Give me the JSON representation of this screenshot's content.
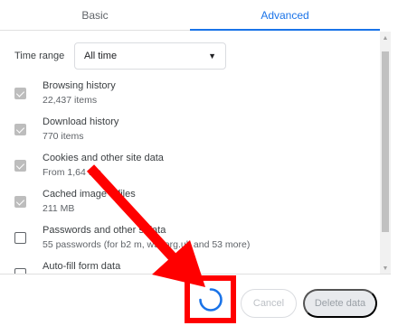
{
  "tabs": {
    "basic_label": "Basic",
    "advanced_label": "Advanced"
  },
  "time_range": {
    "label": "Time range",
    "selected": "All time"
  },
  "items": [
    {
      "title": "Browsing history",
      "subtitle": "22,437 items",
      "checked": true
    },
    {
      "title": "Download history",
      "subtitle": "770 items",
      "checked": true
    },
    {
      "title": "Cookies and other site data",
      "subtitle": "From 1,64 tes",
      "checked": true
    },
    {
      "title": "Cached image d files",
      "subtitle": "211 MB",
      "checked": true
    },
    {
      "title": "Passwords and other s data",
      "subtitle": "55 passwords (for b2 m, w3r.org.uk and 53 more)",
      "checked": false
    },
    {
      "title": "Auto-fill form data",
      "subtitle": "",
      "checked": false
    }
  ],
  "footer": {
    "cancel_label": "Cancel",
    "delete_label": "Delete data"
  },
  "colors": {
    "accent": "#1a73e8",
    "annotation_red": "#ff0000"
  }
}
